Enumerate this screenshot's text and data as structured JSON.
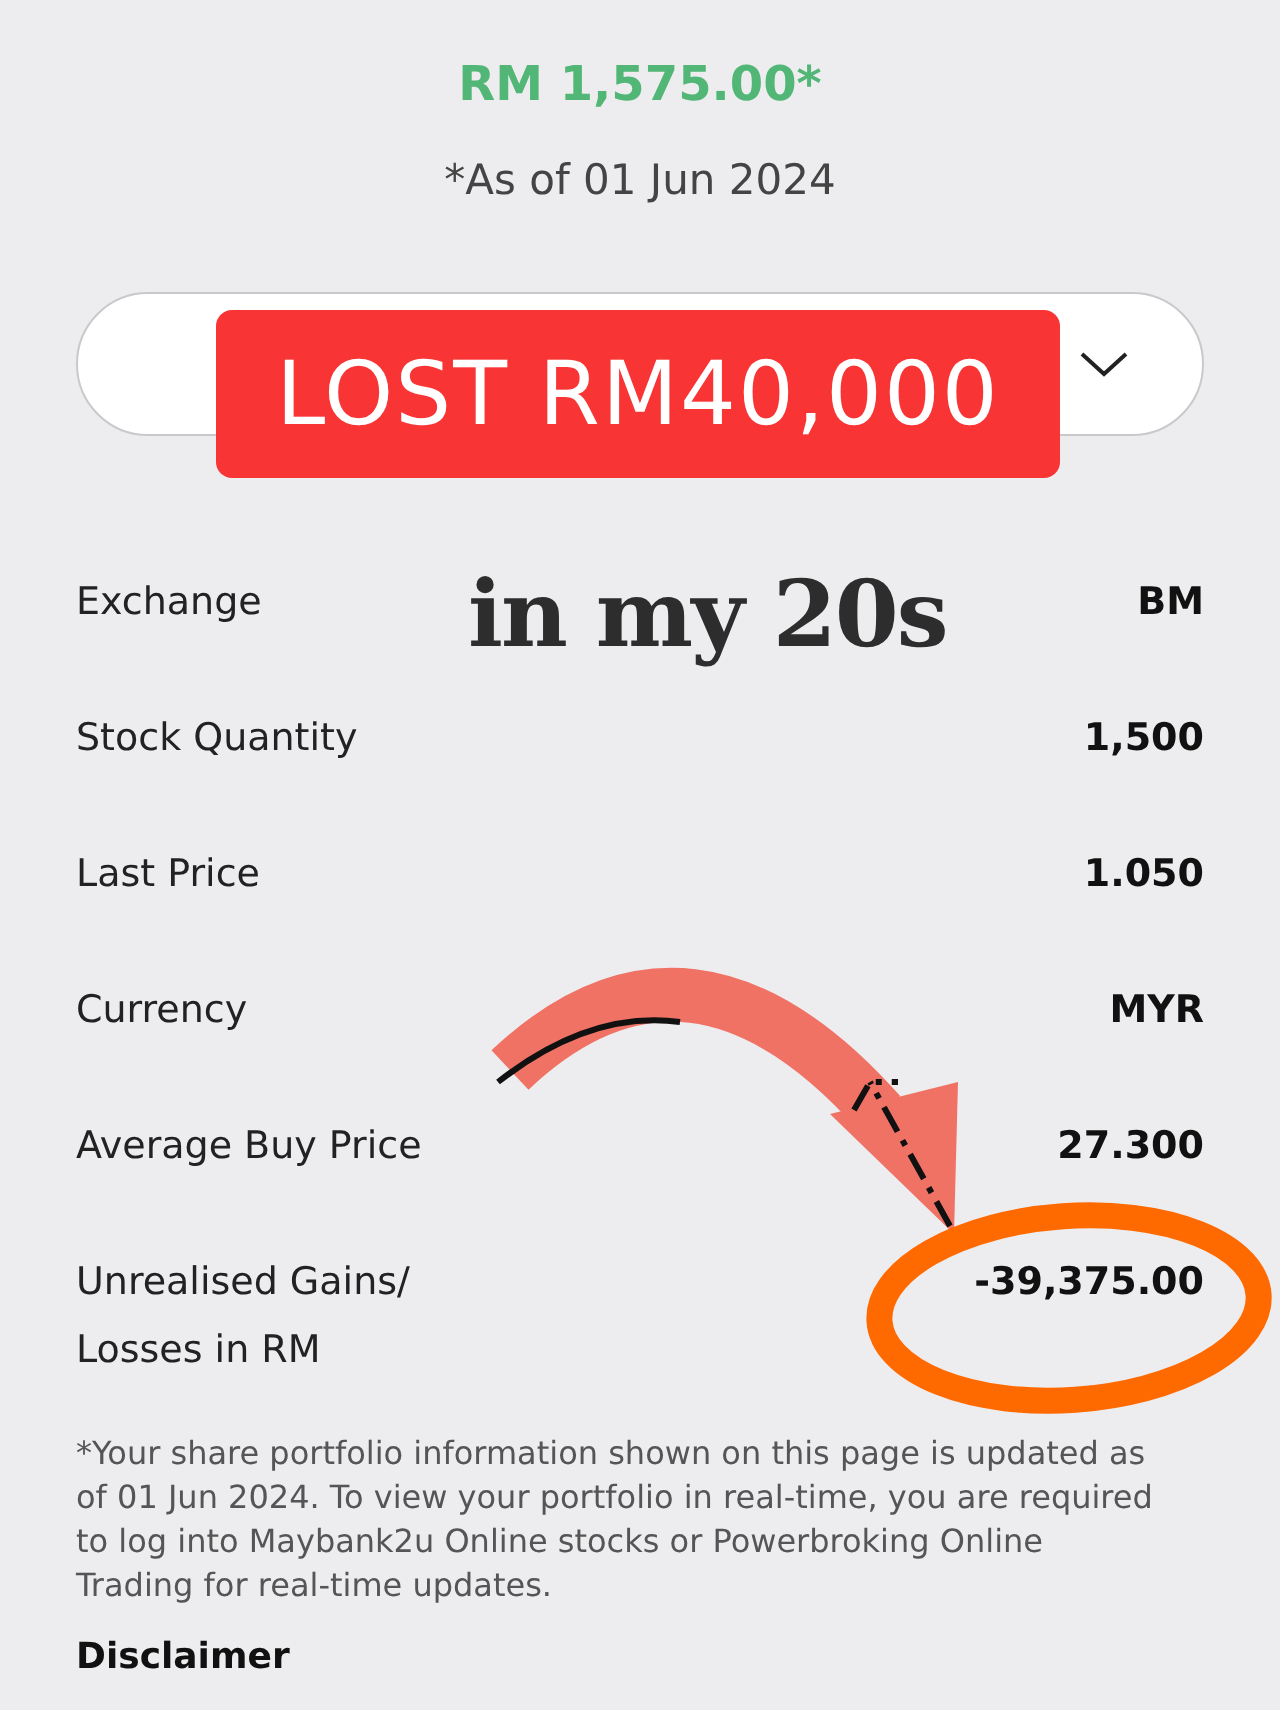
{
  "total_value": "RM 1,575.00*",
  "as_of": "*As of 01 Jun 2024",
  "stickers": [
    {
      "kind": "banner",
      "text": "LOST RM40,000"
    },
    {
      "kind": "headline",
      "text": "in my 20s"
    }
  ],
  "details": [
    {
      "label": "Exchange",
      "value": "BM"
    },
    {
      "label": "Stock Quantity",
      "value": "1,500"
    },
    {
      "label": "Last Price",
      "value": "1.050"
    },
    {
      "label": "Currency",
      "value": "MYR"
    },
    {
      "label": "Average Buy Price",
      "value": "27.300"
    },
    {
      "label": "Unrealised Gains/ Losses in RM",
      "value": "-39,375.00"
    }
  ],
  "footnote": "*Your share portfolio information shown on this page is updated as of 01 Jun 2024. To view your portfolio in real-time, you are required to log into Maybank2u Online stocks or Powerbroking Online Trading for real-time updates.",
  "disclaimer_heading": "Disclaimer"
}
